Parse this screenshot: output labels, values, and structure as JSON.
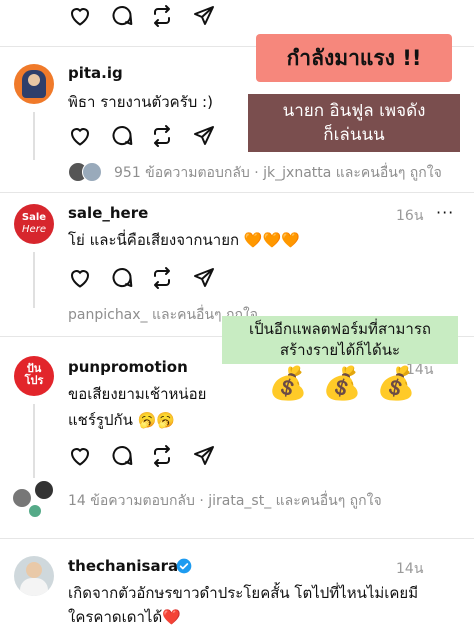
{
  "top_actions": [
    "heart-icon",
    "comment-icon",
    "repost-icon",
    "share-icon"
  ],
  "overlays": {
    "trending": "กำลังมาแรง !!",
    "mayor_line1": "นายก อินฟูล เพจดัง",
    "mayor_line2": "ก็เล่นนน",
    "platform_line1": "เป็นอีกแพลตฟอร์มที่สามารถ",
    "platform_line2": "สร้างรายได้ก็ได้นะ",
    "money": "💰"
  },
  "posts": [
    {
      "username": "pita.ig",
      "text": "พิธา รายงานตัวครับ :)",
      "replies": "951 ข้อความตอบกลับ · jk_jxnatta และคนอื่นๆ ถูกใจ",
      "avatar_color": "#f07a2a"
    },
    {
      "username": "sale_here",
      "time": "16น",
      "dots": "···",
      "text": "โย่ และนี่คือเสียงจากนายก 🧡🧡🧡",
      "replies": "panpichax_ และคนอื่นๆ ถูกใจ",
      "avatar_text_1": "Sale",
      "avatar_text_2": "Here",
      "avatar_color": "#d7262d"
    },
    {
      "username": "punpromotion",
      "time": "14น",
      "text_line1": "ขอเสียงยามเช้าหน่อย",
      "text_line2": "แชร์รูปกัน 🥱🥱",
      "replies": "14 ข้อความตอบกลับ · jirata_st_ และคนอื่นๆ ถูกใจ",
      "avatar_text_1": "ปัน",
      "avatar_text_2": "โปร",
      "avatar_color": "#e2252b"
    },
    {
      "username": "thechanisara",
      "time": "14น",
      "verified": true,
      "text_line1": "เกิดจากตัวอักษรขาวดำประโยคสั้น โตไปที่ไหนไม่เคยมี",
      "text_line2": "ใครคาดเดาได้❤️"
    }
  ]
}
